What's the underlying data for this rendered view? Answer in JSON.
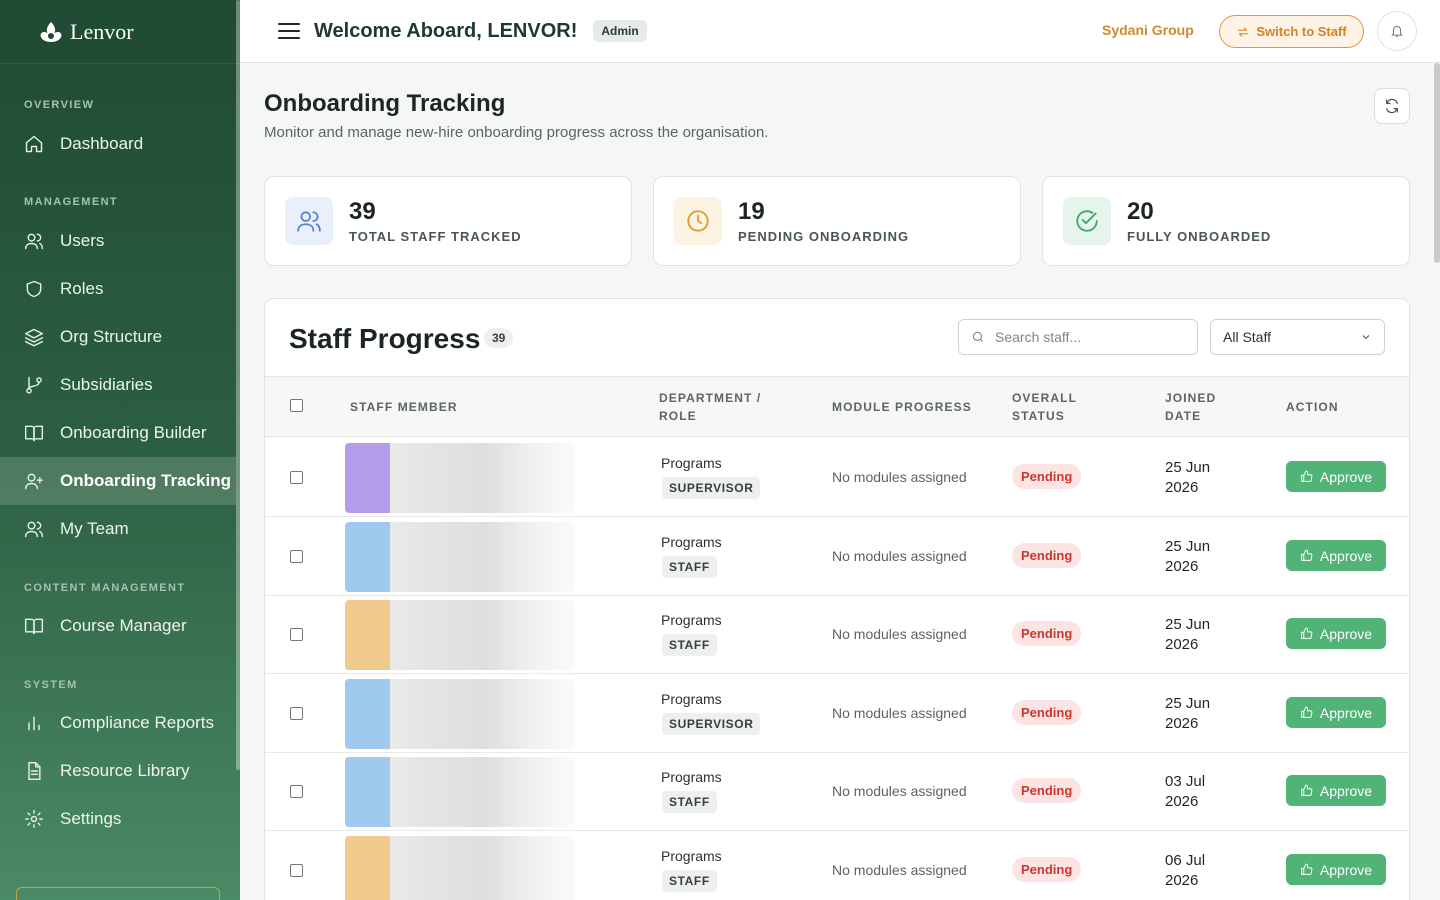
{
  "brand": {
    "name": "Lenvor",
    "logo_icon": "lotus-logo-icon"
  },
  "sidebar": {
    "sections": [
      {
        "label": "OVERVIEW",
        "items": [
          {
            "label": "Dashboard",
            "icon": "home-icon"
          }
        ]
      },
      {
        "label": "MANAGEMENT",
        "items": [
          {
            "label": "Users",
            "icon": "users-icon"
          },
          {
            "label": "Roles",
            "icon": "shield-icon"
          },
          {
            "label": "Org Structure",
            "icon": "layers-icon"
          },
          {
            "label": "Subsidiaries",
            "icon": "branch-icon"
          },
          {
            "label": "Onboarding Builder",
            "icon": "book-icon"
          },
          {
            "label": "Onboarding Tracking",
            "icon": "user-plus-icon",
            "active": true
          },
          {
            "label": "My Team",
            "icon": "team-icon"
          }
        ]
      },
      {
        "label": "CONTENT MANAGEMENT",
        "items": [
          {
            "label": "Course Manager",
            "icon": "book-open-icon"
          }
        ]
      },
      {
        "label": "SYSTEM",
        "items": [
          {
            "label": "Compliance Reports",
            "icon": "bar-chart-icon"
          },
          {
            "label": "Resource Library",
            "icon": "file-text-icon"
          },
          {
            "label": "Settings",
            "icon": "gear-icon"
          }
        ]
      }
    ]
  },
  "header": {
    "welcome": "Welcome Aboard, LENVOR!",
    "role_badge": "Admin",
    "org_name": "Sydani Group",
    "switch_label": "Switch to Staff"
  },
  "page": {
    "title": "Onboarding Tracking",
    "subtitle": "Monitor and manage new-hire onboarding progress across the organisation."
  },
  "stats": [
    {
      "value": "39",
      "label": "TOTAL STAFF TRACKED",
      "icon": "users-icon",
      "color": "#5b7fd6",
      "bg": "#eaf0fb"
    },
    {
      "value": "19",
      "label": "PENDING ONBOARDING",
      "icon": "clock-icon",
      "color": "#e09a33",
      "bg": "#fdf3e3"
    },
    {
      "value": "20",
      "label": "FULLY ONBOARDED",
      "icon": "check-circle-icon",
      "color": "#3fa767",
      "bg": "#e6f5ec"
    }
  ],
  "table": {
    "title": "Staff Progress",
    "count": "39",
    "search_placeholder": "Search staff...",
    "filter_value": "All Staff",
    "columns": {
      "member": "STAFF MEMBER",
      "dept_line1": "DEPARTMENT /",
      "dept_line2": "ROLE",
      "modules": "MODULE PROGRESS",
      "status_line1": "OVERALL",
      "status_line2": "STATUS",
      "joined_line1": "JOINED",
      "joined_line2": "DATE",
      "action": "ACTION"
    },
    "rows": [
      {
        "dept": "Programs",
        "role": "SUPERVISOR",
        "modules": "No modules assigned",
        "status": "Pending",
        "joined_line1": "25 Jun",
        "joined_line2": "2026",
        "action": "Approve",
        "avatar_color": "#a98be8"
      },
      {
        "dept": "Programs",
        "role": "STAFF",
        "modules": "No modules assigned",
        "status": "Pending",
        "joined_line1": "25 Jun",
        "joined_line2": "2026",
        "action": "Approve",
        "avatar_color": "#8fc0ec"
      },
      {
        "dept": "Programs",
        "role": "STAFF",
        "modules": "No modules assigned",
        "status": "Pending",
        "joined_line1": "25 Jun",
        "joined_line2": "2026",
        "action": "Approve",
        "avatar_color": "#efc27a"
      },
      {
        "dept": "Programs",
        "role": "SUPERVISOR",
        "modules": "No modules assigned",
        "status": "Pending",
        "joined_line1": "25 Jun",
        "joined_line2": "2026",
        "action": "Approve",
        "avatar_color": "#8fc0ec"
      },
      {
        "dept": "Programs",
        "role": "STAFF",
        "modules": "No modules assigned",
        "status": "Pending",
        "joined_line1": "03 Jul",
        "joined_line2": "2026",
        "action": "Approve",
        "avatar_color": "#8fc0ec"
      },
      {
        "dept": "Programs",
        "role": "STAFF",
        "modules": "No modules assigned",
        "status": "Pending",
        "joined_line1": "06 Jul",
        "joined_line2": "2026",
        "action": "Approve",
        "avatar_color": "#efc27a"
      }
    ]
  }
}
